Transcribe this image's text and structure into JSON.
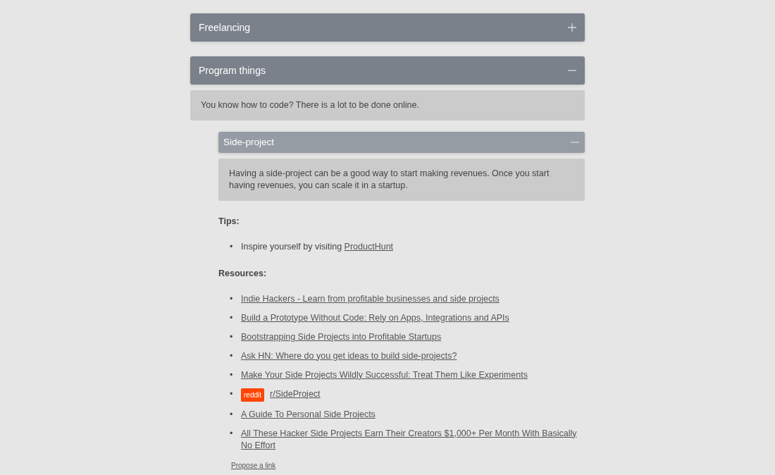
{
  "sections": [
    {
      "title": "Freelancing",
      "expanded": false
    },
    {
      "title": "Program things",
      "expanded": true,
      "description": "You know how to code? There is a lot to be done online.",
      "subsections": [
        {
          "title": "Side-project",
          "expanded": true,
          "description": "Having a side-project can be a good way to start making revenues. Once you start having revenues, you can scale it in a startup.",
          "tips_heading": "Tips:",
          "tips": [
            {
              "marker": "•",
              "text": "Inspire yourself by visiting ",
              "link": "ProductHunt"
            }
          ],
          "resources_heading": "Resources:",
          "resources": [
            {
              "marker": "•",
              "link": "Indie Hackers - Learn from profitable businesses and side projects"
            },
            {
              "marker": "•",
              "link": "Build a Prototype Without Code: Rely on Apps, Integrations and APIs"
            },
            {
              "marker": "•",
              "link": "Bootstrapping Side Projects into Profitable Startups"
            },
            {
              "marker": "•",
              "link": "Ask HN: Where do you get ideas to build side-projects?"
            },
            {
              "marker": "•",
              "link": "Make Your Side Projects Wildly Successful: Treat Them Like Experiments"
            },
            {
              "marker": "•",
              "badge": "reddit",
              "link": "r/SideProject"
            },
            {
              "marker": "•",
              "link": "A Guide To Personal Side Projects"
            },
            {
              "marker": "•",
              "link": "All These Hacker Side Projects Earn Their Creators $1,000+ Per Month With Basically No Effort"
            }
          ],
          "propose_link": "Propose a link"
        }
      ]
    }
  ]
}
